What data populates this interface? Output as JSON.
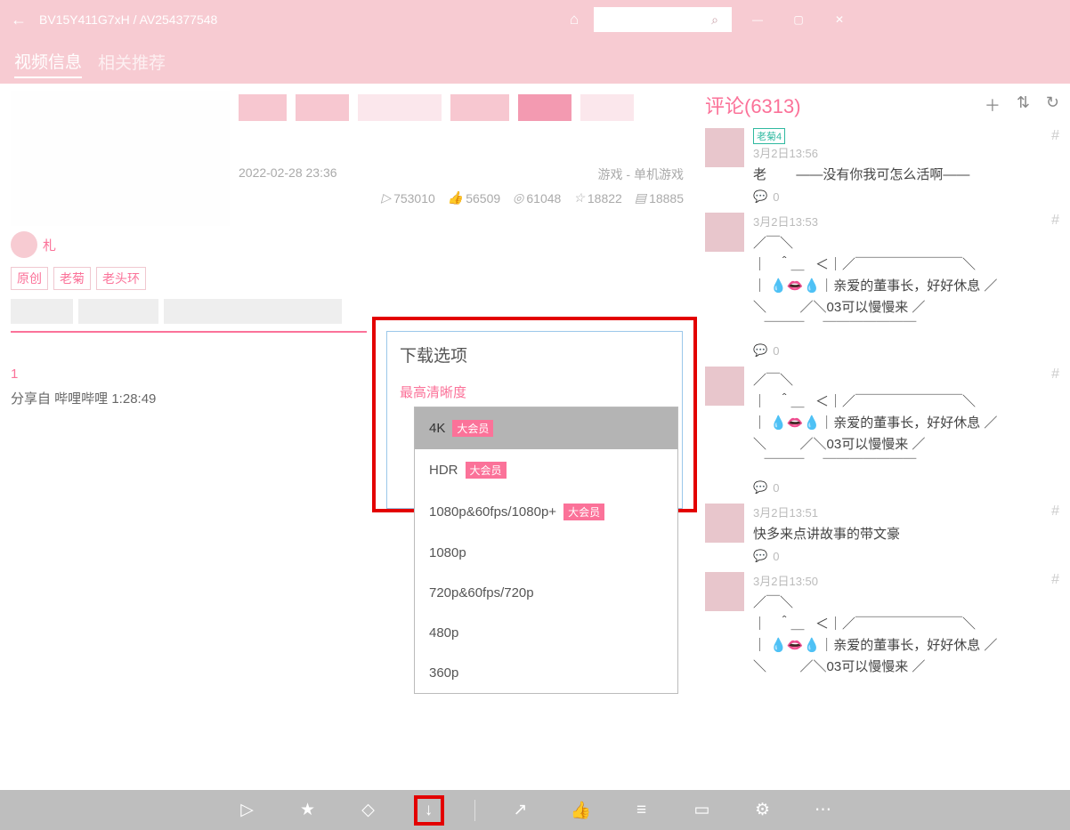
{
  "titlebar": {
    "title": "BV15Y411G7xH / AV254377548"
  },
  "tabs": {
    "info": "视频信息",
    "related": "相关推荐"
  },
  "video": {
    "date": "2022-02-28 23:36",
    "category": "游戏 - 单机游戏",
    "plays": "753010",
    "likes": "56509",
    "coins": "61048",
    "favs": "18822",
    "danmu": "18885",
    "uploader": "札",
    "tags": [
      "原创",
      "老菊",
      "老头环"
    ],
    "part_no": "1",
    "share": "分享自 哔哩哔哩 1:28:49"
  },
  "download": {
    "title": "下载选项",
    "subtitle": "最高清晰度",
    "vip_badge": "大会员",
    "options": [
      {
        "label": "4K",
        "vip": true,
        "selected": true
      },
      {
        "label": "HDR",
        "vip": true
      },
      {
        "label": "1080p&60fps/1080p+",
        "vip": true
      },
      {
        "label": "1080p"
      },
      {
        "label": "720p&60fps/720p"
      },
      {
        "label": "480p"
      },
      {
        "label": "360p"
      }
    ]
  },
  "comments": {
    "header": "评论(6313)",
    "items": [
      {
        "badge": "老菊4",
        "time": "3月2日13:56",
        "text": "老        ——没有你我可怎么活啊——",
        "replies": "0"
      },
      {
        "time": "3月2日13:53",
        "text": "／￣＼\n｜   ＾＿   ＜｜／￣￣￣￣￣￣￣￣＼\n｜ 💧👄💧｜亲爱的董事长，好好休息 ／\n＼         ／＼03可以慢慢来 ／\n   ￣￣￣     ￣￣￣￣￣￣￣",
        "replies": "0"
      },
      {
        "text": "／￣＼\n｜   ＾＿   ＜｜／￣￣￣￣￣￣￣￣＼\n｜ 💧👄💧｜亲爱的董事长，好好休息 ／\n＼         ／＼03可以慢慢来 ／\n   ￣￣￣     ￣￣￣￣￣￣￣",
        "replies": "0"
      },
      {
        "time": "3月2日13:51",
        "text": "快多来点讲故事的带文豪",
        "replies": "0"
      },
      {
        "time": "3月2日13:50",
        "text": "／￣＼\n｜   ＾＿   ＜｜／￣￣￣￣￣￣￣￣＼\n｜ 💧👄💧｜亲爱的董事长，好好休息 ／\n＼         ／＼03可以慢慢来 ／"
      }
    ]
  }
}
